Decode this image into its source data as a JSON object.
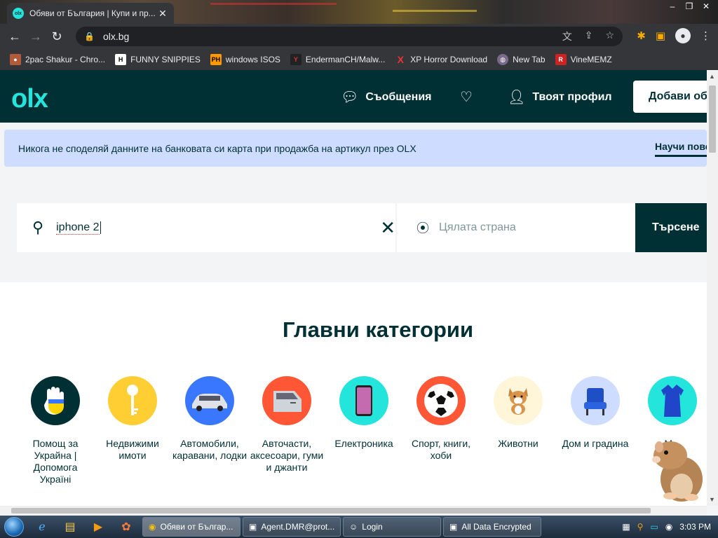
{
  "browser": {
    "tab_title": "Обяви от България | Купи и пр...",
    "tab_close": "✕",
    "url": "olx.bg",
    "bookmarks": [
      {
        "label": "2pac Shakur - Chro...",
        "icon": "tupac-icon"
      },
      {
        "label": "FUNNY SNIPPIES",
        "icon": "h-icon"
      },
      {
        "label": "windows ISOS",
        "icon": "ph-icon"
      },
      {
        "label": "EndermanCH/Malw...",
        "icon": "yt-icon"
      },
      {
        "label": "XP Horror Download",
        "icon": "x-icon"
      },
      {
        "label": "New Tab",
        "icon": "globe-icon"
      },
      {
        "label": "VineMEMZ",
        "icon": "r-icon"
      }
    ]
  },
  "header": {
    "logo": "olx",
    "messages_label": "Съобщения",
    "profile_label": "Твоят профил",
    "add_label": "Добави обя"
  },
  "banner": {
    "text": "Никога не споделяй данните на банковата си карта при продажба на артикул през OLX",
    "learn_more": "Научи повече"
  },
  "search": {
    "query": "iphone 2",
    "location_placeholder": "Цялата страна",
    "button_label": "Търсене"
  },
  "categories": {
    "title": "Главни категории",
    "items": [
      {
        "label": "Помощ за Украйна | Допомога Україні",
        "icon": "ukraine-hand-icon",
        "color": "#002f34"
      },
      {
        "label": "Недвижими имоти",
        "icon": "key-icon",
        "color": "#ffce32"
      },
      {
        "label": "Автомобили, каравани, лодки",
        "icon": "car-icon",
        "color": "#3a77ff"
      },
      {
        "label": "Авточасти, аксесоари, гуми и джанти",
        "icon": "car-door-icon",
        "color": "#ff5636"
      },
      {
        "label": "Електроника",
        "icon": "phone-icon",
        "color": "#23e5db"
      },
      {
        "label": "Спорт, книги, хоби",
        "icon": "football-icon",
        "color": "#ff5636"
      },
      {
        "label": "Животни",
        "icon": "dog-icon",
        "color": "#fff6d9"
      },
      {
        "label": "Дом и градина",
        "icon": "chair-icon",
        "color": "#cedcff"
      },
      {
        "label": "М...",
        "icon": "dress-icon",
        "color": "#3a77ff"
      }
    ]
  },
  "taskbar": {
    "buttons": [
      {
        "label": "Обяви от Българ...",
        "icon": "chrome-icon",
        "active": true
      },
      {
        "label": "Agent.DMR@prot...",
        "icon": "window-icon",
        "active": false
      },
      {
        "label": "Login",
        "icon": "user-icon",
        "active": false
      },
      {
        "label": "All Data Encrypted",
        "icon": "window-icon",
        "active": false
      }
    ],
    "clock": "3:03 PM"
  }
}
